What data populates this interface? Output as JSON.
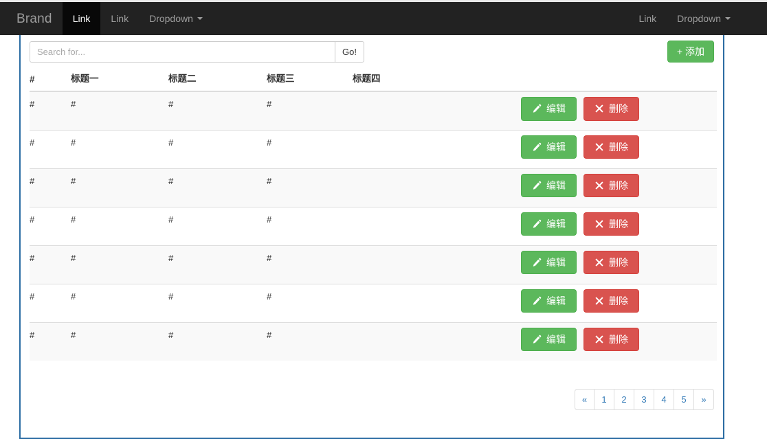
{
  "navbar": {
    "brand": "Brand",
    "left_items": [
      {
        "label": "Link",
        "active": true,
        "dropdown": false
      },
      {
        "label": "Link",
        "active": false,
        "dropdown": false
      },
      {
        "label": "Dropdown",
        "active": false,
        "dropdown": true
      }
    ],
    "right_items": [
      {
        "label": "Link",
        "active": false,
        "dropdown": false
      },
      {
        "label": "Dropdown",
        "active": false,
        "dropdown": true
      }
    ],
    "background_color": "#222222",
    "active_background_color": "#080808",
    "link_color": "#9d9d9d"
  },
  "toolbar": {
    "search_placeholder": "Search for...",
    "search_value": "",
    "go_label": "Go!",
    "add_label": "+ 添加",
    "add_color": "#5cb85c"
  },
  "table": {
    "headers": [
      "#",
      "标题一",
      "标题二",
      "标题三",
      "标题四",
      ""
    ],
    "rows": [
      {
        "hash": "#",
        "c1": "#",
        "c2": "#",
        "c3": "#",
        "c4": ""
      },
      {
        "hash": "#",
        "c1": "#",
        "c2": "#",
        "c3": "#",
        "c4": ""
      },
      {
        "hash": "#",
        "c1": "#",
        "c2": "#",
        "c3": "#",
        "c4": ""
      },
      {
        "hash": "#",
        "c1": "#",
        "c2": "#",
        "c3": "#",
        "c4": ""
      },
      {
        "hash": "#",
        "c1": "#",
        "c2": "#",
        "c3": "#",
        "c4": ""
      },
      {
        "hash": "#",
        "c1": "#",
        "c2": "#",
        "c3": "#",
        "c4": ""
      },
      {
        "hash": "#",
        "c1": "#",
        "c2": "#",
        "c3": "#",
        "c4": ""
      }
    ],
    "edit_label": "编辑",
    "delete_label": "删除",
    "edit_icon": "pencil-icon",
    "delete_icon": "times-icon",
    "edit_color": "#5cb85c",
    "delete_color": "#d9534f",
    "stripe_color": "#f9f9f9"
  },
  "pagination": {
    "items": [
      "«",
      "1",
      "2",
      "3",
      "4",
      "5",
      "»"
    ],
    "link_color": "#337ab7"
  },
  "panel": {
    "border_color": "#2b6ca3"
  }
}
